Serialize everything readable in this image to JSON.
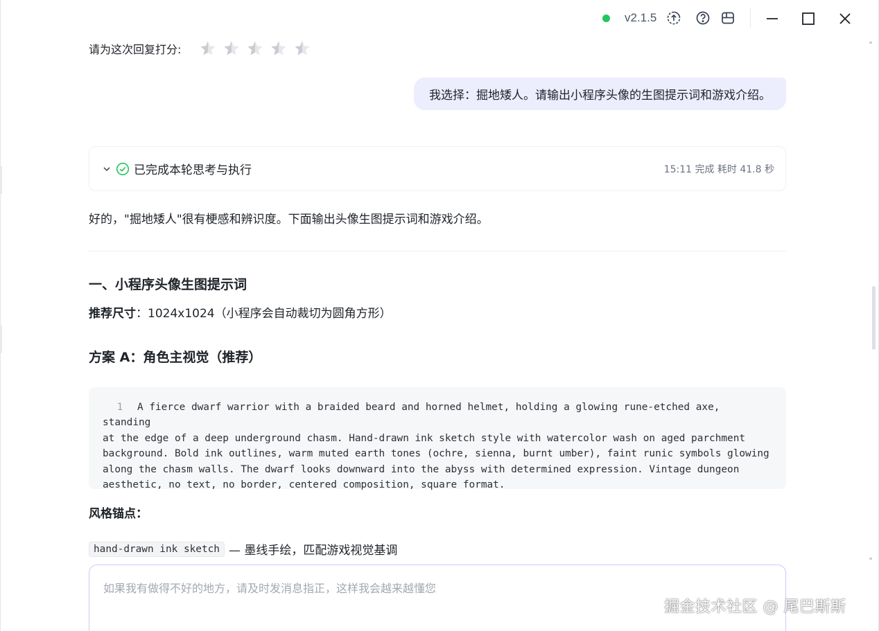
{
  "titlebar": {
    "status_color": "#22c55e",
    "version": "v2.1.5",
    "icons": [
      "upload-circle-icon",
      "help-circle-icon",
      "panel-icon"
    ],
    "window_controls": [
      "minimize-icon",
      "maximize-icon",
      "close-icon"
    ]
  },
  "rating": {
    "label": "请为这次回复打分:",
    "max_stars": 5,
    "value": 0
  },
  "user_message": {
    "text": "我选择：掘地矮人。请输出小程序头像的生图提示词和游戏介绍。",
    "bubble_color": "#eceefe"
  },
  "thinking": {
    "title": "已完成本轮思考与执行",
    "meta": "15:11 完成 耗时 41.8 秒",
    "check_color": "#22c55e"
  },
  "reply": {
    "intro": "好的，\"掘地矮人\"很有梗感和辨识度。下面输出头像生图提示词和游戏介绍。",
    "section_heading": "一、小程序头像生图提示词",
    "size_label": "推荐尺寸",
    "size_value": "：1024x1024（小程序会自动裁切为圆角方形）",
    "plan_heading": "方案 A：角色主视觉（推荐）",
    "code": {
      "line_number": "1",
      "lines": [
        "A fierce dwarf warrior with a braided beard and horned helmet, holding a glowing rune-etched axe, standing",
        "at the edge of a deep underground chasm. Hand-drawn ink sketch style with watercolor wash on aged parchment",
        "background. Bold ink outlines, warm muted earth tones (ochre, sienna, burnt umber), faint runic symbols glowing",
        "along the chasm walls. The dwarf looks downward into the abyss with determined expression. Vintage dungeon",
        "aesthetic, no text, no border, centered composition, square format."
      ]
    },
    "anchor_title": "风格锚点：",
    "anchor_code": "hand-drawn ink sketch",
    "anchor_desc": "— 墨线手绘，匹配游戏视觉基调"
  },
  "input": {
    "placeholder": "如果我有做得不好的地方，请及时发消息指正，这样我会越来越懂您",
    "value": ""
  },
  "watermark": "掘金技术社区 @ 尾巴斯斯"
}
